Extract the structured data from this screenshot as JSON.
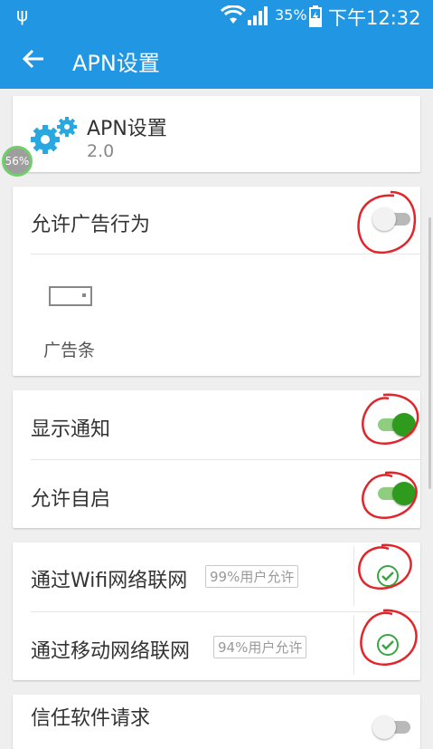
{
  "status_bar": {
    "battery_percent": "35%",
    "time": "下午12:32"
  },
  "toolbar": {
    "title": "APN设置"
  },
  "app_info": {
    "name": "APN设置",
    "version": "2.0",
    "progress_badge": "56%"
  },
  "ad_section": {
    "allow_ads_label": "允许广告行为",
    "allow_ads_enabled": false,
    "banner_label": "广告条"
  },
  "behavior_section": {
    "show_notification_label": "显示通知",
    "show_notification_enabled": true,
    "auto_start_label": "允许自启",
    "auto_start_enabled": true
  },
  "network_section": {
    "wifi_label": "通过Wifi网络联网",
    "wifi_badge": "99%用户允许",
    "wifi_checked": true,
    "mobile_label": "通过移动网络联网",
    "mobile_badge": "94%用户允许",
    "mobile_checked": true
  },
  "trust_section": {
    "trust_request_label": "信任软件请求"
  },
  "colors": {
    "primary": "#2196e3",
    "toggle_on": "#2e9b1e",
    "check": "#3aa544",
    "annotation": "#e0262b"
  }
}
